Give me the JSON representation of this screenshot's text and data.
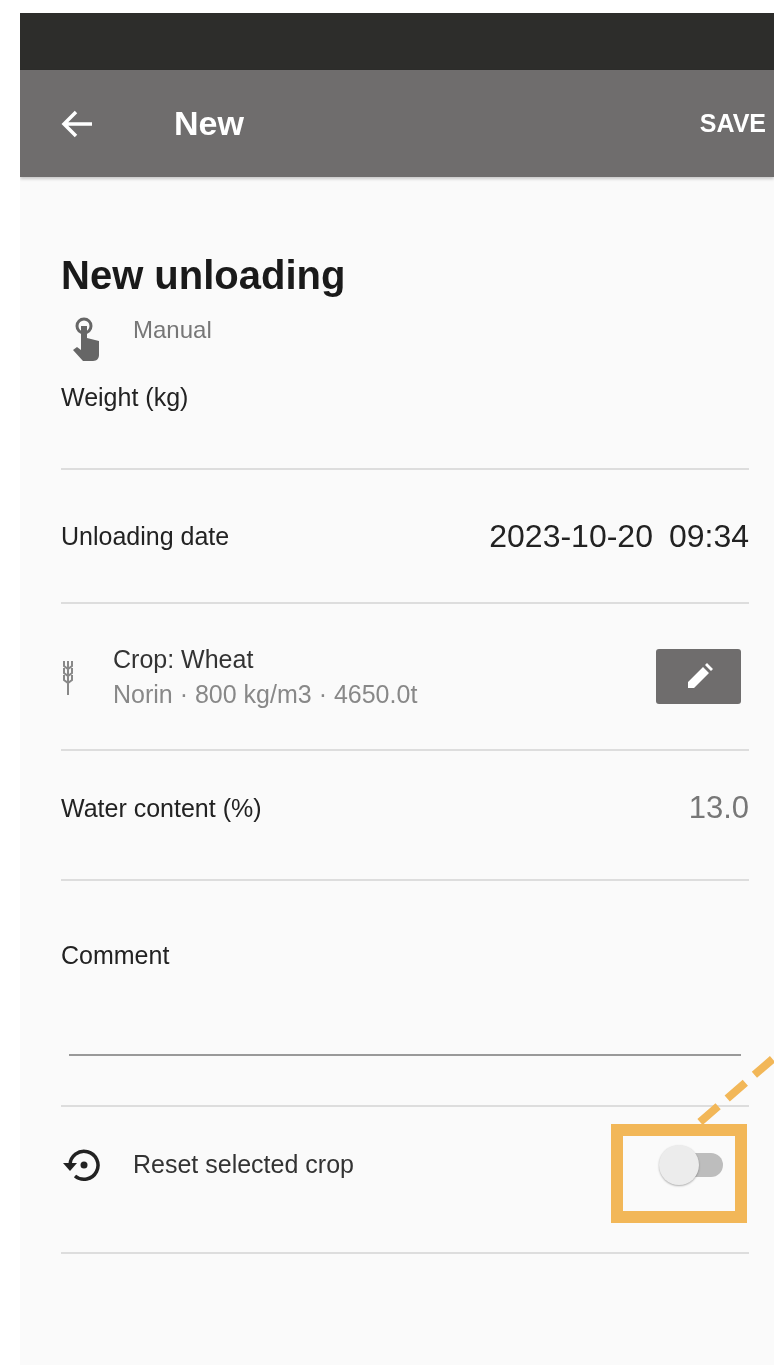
{
  "app_bar": {
    "title": "New",
    "action": "SAVE"
  },
  "heading": "New unloading",
  "mode": {
    "label": "Manual"
  },
  "weight": {
    "label": "Weight (kg)"
  },
  "unloading_date": {
    "label": "Unloading date",
    "date": "2023-10-20",
    "time": "09:34"
  },
  "crop": {
    "title": "Crop: Wheat",
    "details": "Norin · 800 kg/m3 · 4650.0t"
  },
  "water_content": {
    "label": "Water content (%)",
    "value": "13.0"
  },
  "comment": {
    "label": "Comment"
  },
  "reset_crop": {
    "label": "Reset selected crop",
    "on": false
  }
}
